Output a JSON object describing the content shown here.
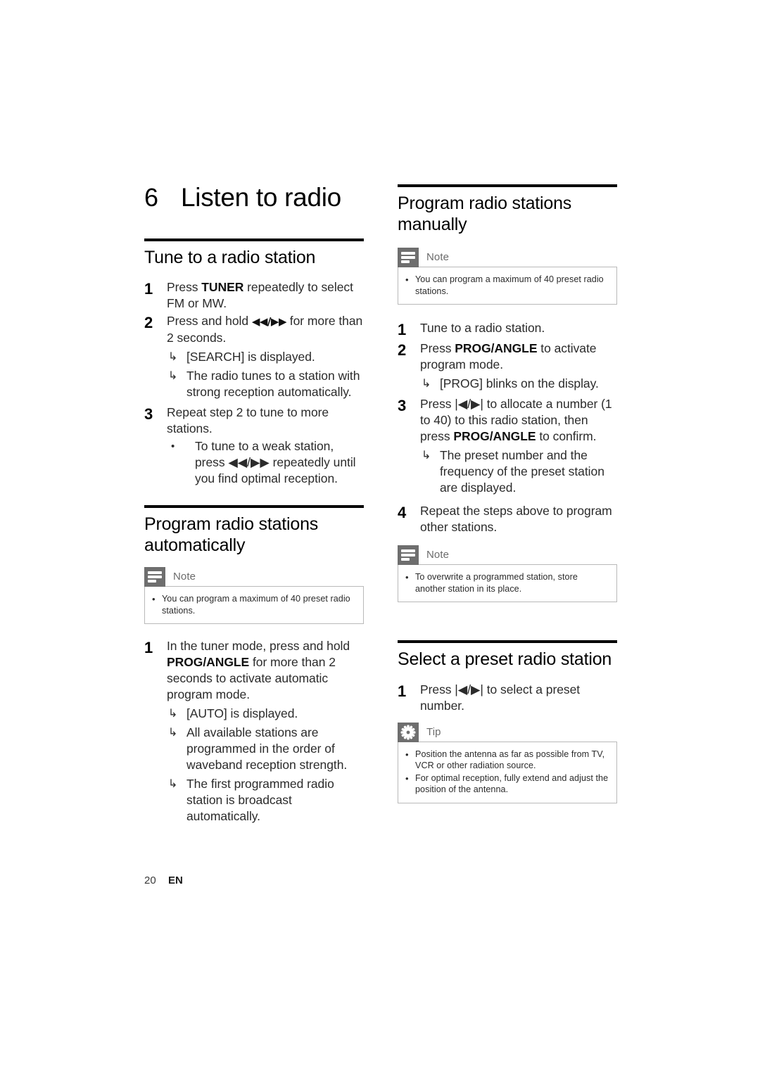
{
  "document": {
    "chapter_number": "6",
    "chapter_title": "Listen to radio",
    "footer_page": "20",
    "footer_language": "EN"
  },
  "icons": {
    "note": "note-icon",
    "tip": "tip-star-icon",
    "result_arrow": "↳",
    "bullet": "•",
    "rewind": "◀◀",
    "forward": "▶▶",
    "prev_track": "|◀",
    "next_track": "▶|"
  },
  "left_column": {
    "section_tune": {
      "heading": "Tune to a radio station",
      "steps": [
        {
          "num": "1",
          "text_before": "Press ",
          "bold": "TUNER",
          "text_after": " repeatedly to select FM or MW.",
          "results": [],
          "subbullets": []
        },
        {
          "num": "2",
          "text_before": "Press and hold ",
          "bold": "◀◀/▶▶",
          "text_after": " for more than 2 seconds.",
          "results": [
            "[SEARCH] is displayed.",
            "The radio tunes to a station with strong reception automatically."
          ],
          "subbullets": []
        },
        {
          "num": "3",
          "text_before": "Repeat step 2 to tune to more stations.",
          "bold": "",
          "text_after": "",
          "results": [],
          "subbullets": [
            "To tune to a weak station, press ◀◀/▶▶ repeatedly until you find optimal reception."
          ]
        }
      ]
    },
    "section_auto": {
      "heading": "Program radio stations automatically",
      "note": {
        "label": "Note",
        "items": [
          "You can program a maximum of 40 preset radio stations."
        ]
      },
      "steps": [
        {
          "num": "1",
          "text_before": "In the tuner mode, press and hold ",
          "bold": "PROG/ANGLE",
          "text_after": " for more than 2 seconds to activate automatic program mode.",
          "results": [
            "[AUTO] is displayed.",
            "All available stations are programmed in the order of waveband reception strength.",
            "The first programmed radio station is broadcast automatically."
          ],
          "subbullets": []
        }
      ]
    }
  },
  "right_column": {
    "section_manual": {
      "heading": "Program radio stations manually",
      "note_top": {
        "label": "Note",
        "items": [
          "You can program a maximum of 40 preset radio stations."
        ]
      },
      "steps": [
        {
          "num": "1",
          "text_before": "Tune to a radio station.",
          "bold": "",
          "text_after": "",
          "results": [],
          "subbullets": []
        },
        {
          "num": "2",
          "text_before": "Press ",
          "bold": "PROG/ANGLE",
          "text_after": " to activate program mode.",
          "results": [
            "[PROG] blinks on the display."
          ],
          "subbullets": []
        },
        {
          "num": "3",
          "text_before": "Press |◀/▶| to allocate a number (1 to 40) to this radio station, then press ",
          "bold": "PROG/ANGLE",
          "text_after": " to confirm.",
          "results": [
            "The preset number and the frequency of the preset station are displayed."
          ],
          "subbullets": []
        },
        {
          "num": "4",
          "text_before": "Repeat the steps above to program other stations.",
          "bold": "",
          "text_after": "",
          "results": [],
          "subbullets": []
        }
      ],
      "note_bottom": {
        "label": "Note",
        "items": [
          "To overwrite a programmed station, store another station in its place."
        ]
      }
    },
    "section_select": {
      "heading": "Select a preset radio station",
      "steps": [
        {
          "num": "1",
          "text_before": "Press |◀/▶| to select a preset number.",
          "bold": "",
          "text_after": "",
          "results": [],
          "subbullets": []
        }
      ],
      "tip": {
        "label": "Tip",
        "items": [
          "Position the antenna as far as possible from TV, VCR or other radiation source.",
          "For optimal reception, fully extend and adjust the position of the antenna."
        ]
      }
    }
  },
  "colors": {
    "rule": "#000000",
    "callout_icon_bg": "#6e6e6e",
    "callout_border": "#b9b9b9",
    "body_text": "#2b2b2b"
  }
}
